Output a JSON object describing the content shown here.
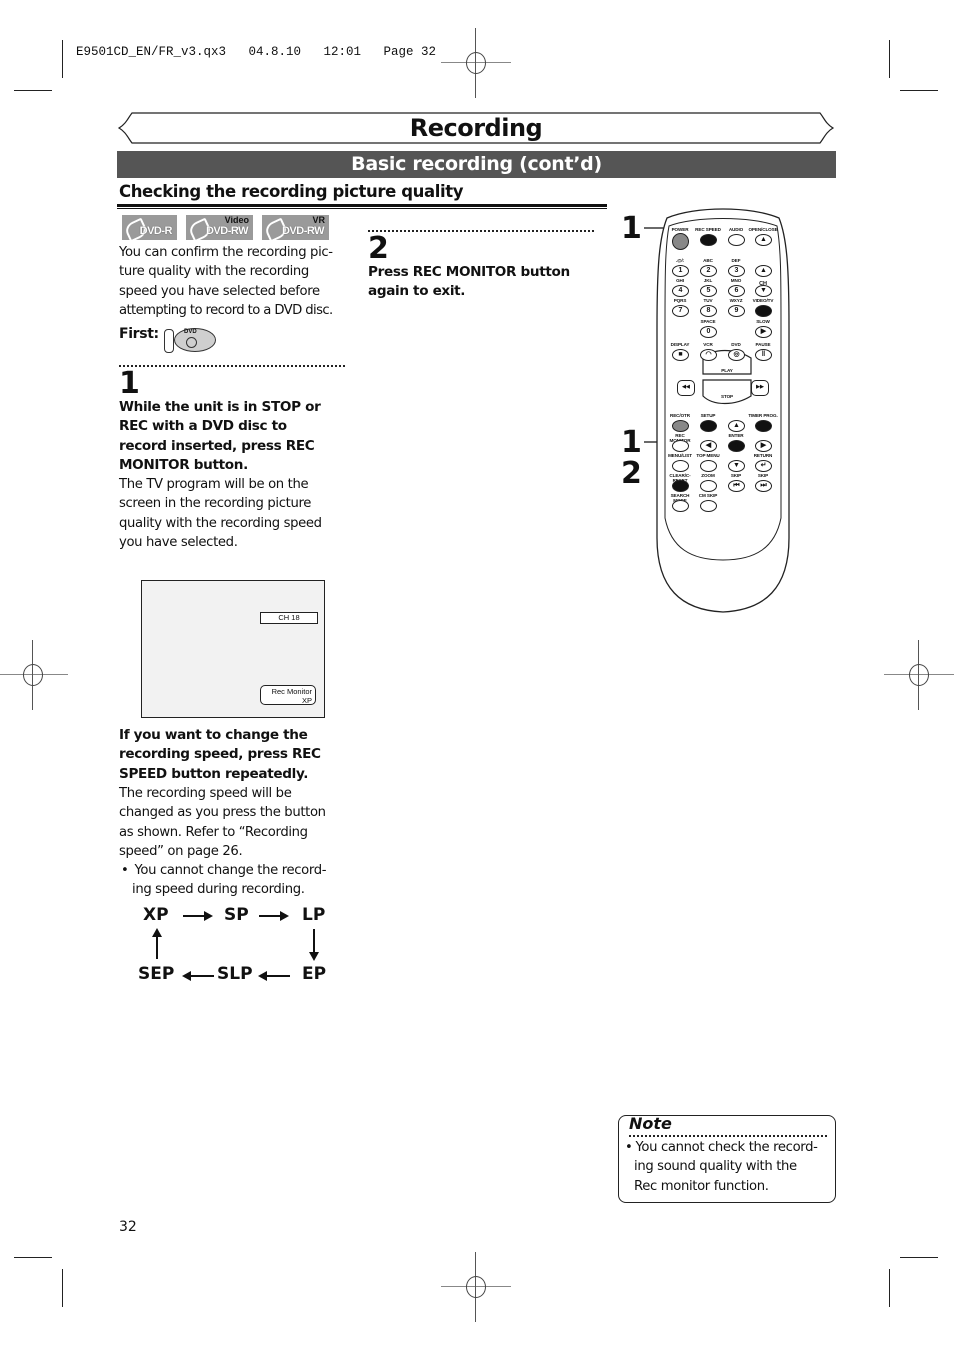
{
  "print_header": {
    "slug": "E9501CD_EN/FR_v3.qx3   04.8.10   12:01   Page 32"
  },
  "page": {
    "chapter_title": "Recording",
    "section_title": "Basic recording (cont’d)",
    "subsection_title": "Checking the recording picture quality",
    "page_number": "32"
  },
  "disc_badges": [
    {
      "label": "DVD-R",
      "superscript": ""
    },
    {
      "label": "DVD-RW",
      "superscript": "Video"
    },
    {
      "label": "DVD-RW",
      "superscript": "VR"
    }
  ],
  "intro": {
    "lines": [
      "You can confirm the recording pic-",
      "ture quality with the recording",
      "speed you have selected before",
      "attempting to record to a DVD disc."
    ],
    "first_label": "First:",
    "first_icon": "dvd-mode-icon",
    "first_icon_text": "DVD"
  },
  "step1": {
    "number": "1",
    "instruction_lines": [
      "While the unit is in STOP or",
      "REC with a DVD disc to",
      "record inserted, press REC",
      "MONITOR button."
    ],
    "description_lines": [
      "The TV program will be on the",
      "screen in the recording picture",
      "quality with the recording speed",
      "you have selected."
    ]
  },
  "tv_screen": {
    "channel": "CH 18",
    "rec_monitor_label": "Rec Monitor",
    "rec_monitor_speed": "XP"
  },
  "speed_change": {
    "instruction_lines": [
      "If you want to change the",
      "recording speed, press REC",
      "SPEED button repeatedly."
    ],
    "description_lines": [
      "The recording speed will be",
      "changed as you press the button",
      "as shown. Refer to “Recording",
      "speed” on page 26."
    ],
    "bullet_lines": [
      "You cannot change the record-",
      "ing speed during recording."
    ],
    "cycle": [
      "XP",
      "SP",
      "LP",
      "EP",
      "SLP",
      "SEP"
    ]
  },
  "step2": {
    "number": "2",
    "instruction_lines": [
      "Press REC MONITOR button",
      "again to exit."
    ]
  },
  "remote": {
    "callouts": [
      {
        "number": "1",
        "target": "REC SPEED"
      },
      {
        "number": "1",
        "target": "REC MONITOR"
      },
      {
        "number": "2",
        "target": "REC MONITOR"
      }
    ],
    "rows": [
      {
        "labels": [
          "POWER",
          "REC SPEED",
          "AUDIO",
          "OPEN/CLOSE"
        ],
        "glyphs": [
          "",
          "",
          "",
          "▲"
        ]
      },
      {
        "labels": [
          ".@/:",
          "ABC",
          "DEF",
          ""
        ],
        "glyphs": [
          "1",
          "2",
          "3",
          "▲"
        ]
      },
      {
        "labels": [
          "GHI",
          "JKL",
          "MNO",
          "CH"
        ],
        "glyphs": [
          "4",
          "5",
          "6",
          "▼"
        ]
      },
      {
        "labels": [
          "PQRS",
          "TUV",
          "WXYZ",
          "VIDEO/TV"
        ],
        "glyphs": [
          "7",
          "8",
          "9",
          ""
        ]
      },
      {
        "labels": [
          "",
          "SPACE",
          "",
          "SLOW"
        ],
        "glyphs": [
          "",
          "0",
          "",
          "▶"
        ]
      },
      {
        "labels": [
          "DISPLAY",
          "VCR",
          "DVD",
          "PAUSE"
        ],
        "glyphs": [
          "■",
          "◠",
          "◎",
          "‖"
        ]
      },
      {
        "labels": [
          "PLAY",
          "STOP"
        ],
        "glyphs": [
          "◀◀",
          "▶▶"
        ]
      },
      {
        "labels": [
          "REC/OTR",
          "SETUP",
          "",
          "TIMER PROG."
        ],
        "glyphs": [
          "",
          "",
          "▲",
          ""
        ]
      },
      {
        "labels": [
          "REC MONITOR",
          "",
          "ENTER",
          ""
        ],
        "glyphs": [
          "",
          "◀",
          "●",
          "▶"
        ]
      },
      {
        "labels": [
          "MENU/LIST",
          "TOP MENU",
          "",
          "RETURN"
        ],
        "glyphs": [
          "",
          "",
          "▼",
          "↵"
        ]
      },
      {
        "labels": [
          "CLEAR/C-RESET",
          "ZOOM",
          "SKIP",
          "SKIP"
        ],
        "glyphs": [
          "",
          "",
          "⏮",
          "⏭"
        ]
      },
      {
        "labels": [
          "SEARCH MODE",
          "CM SKIP"
        ],
        "glyphs": [
          "",
          ""
        ]
      }
    ]
  },
  "note": {
    "title": "Note",
    "bullet_lines": [
      "You cannot check the record-",
      "ing sound quality with the",
      "Rec monitor function."
    ]
  },
  "colors": {
    "section_bar": "#555555",
    "badge_bg": "#9a9a9a",
    "screen_bg": "#f2f2f2",
    "power_button": "#888888"
  }
}
